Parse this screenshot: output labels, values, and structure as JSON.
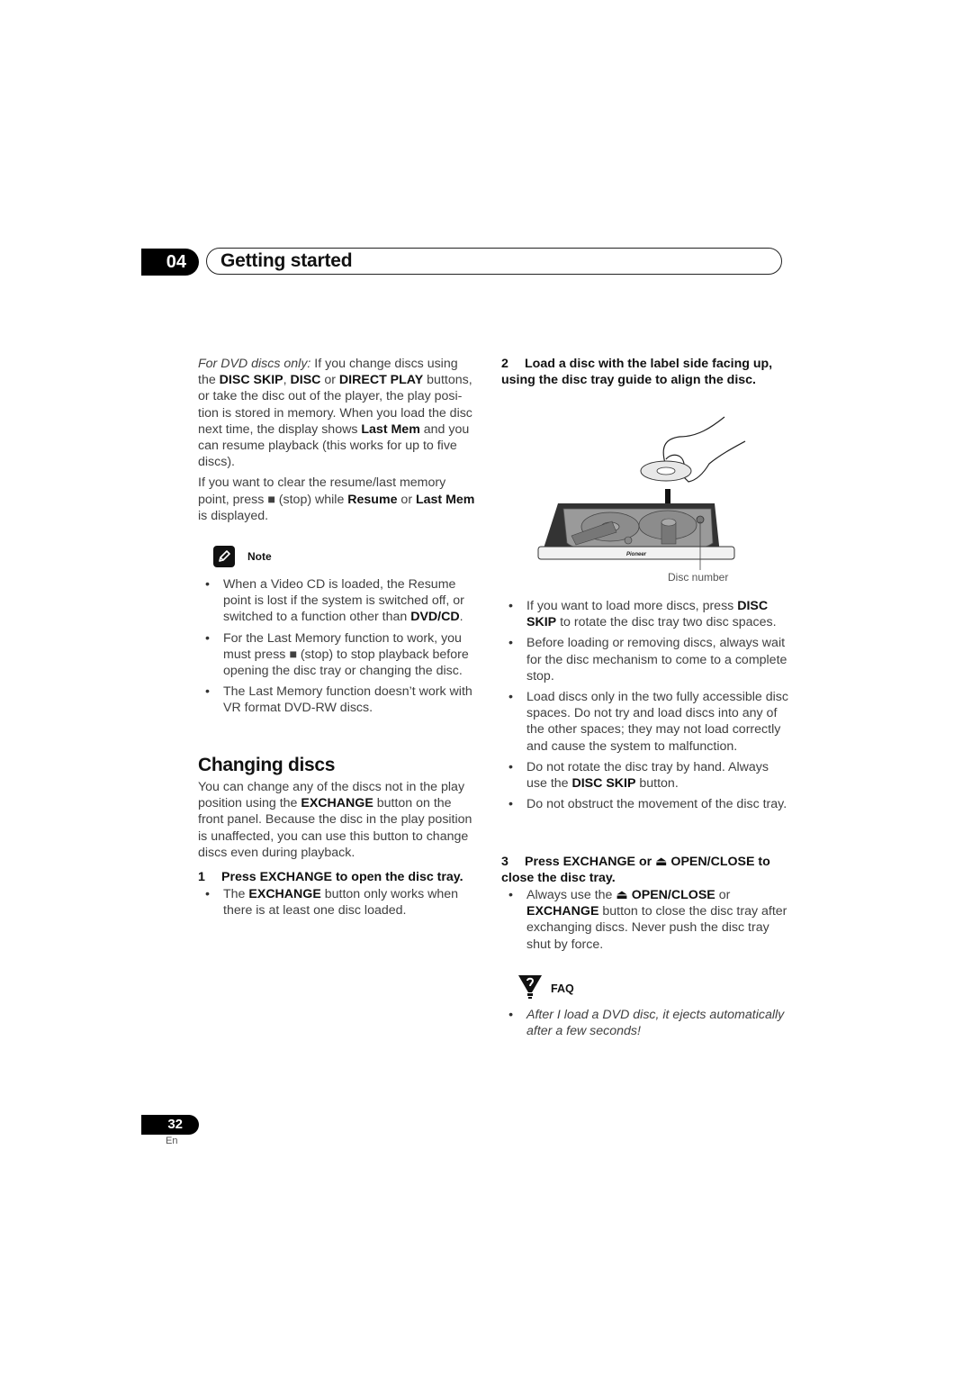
{
  "header": {
    "chapter_number": "04",
    "chapter_title": "Getting started"
  },
  "left": {
    "intro_para": {
      "italic_lead": "For DVD discs only:",
      "segments": [
        {
          "t": " If you change discs using the ",
          "b": false
        },
        {
          "t": "DISC SKIP",
          "b": true
        },
        {
          "t": ", ",
          "b": false
        },
        {
          "t": "DISC",
          "b": true
        },
        {
          "t": " or ",
          "b": false
        },
        {
          "t": "DIRECT PLAY",
          "b": true
        },
        {
          "t": " buttons, or take the disc out of the player, the play posi-tion is stored in memory. When you load the disc next time, the display shows ",
          "b": false
        },
        {
          "t": "Last Mem",
          "b": true
        },
        {
          "t": " and you can resume playback (this works for up to five discs).",
          "b": false
        }
      ]
    },
    "clear_para": {
      "segments": [
        {
          "t": "If you want to clear the resume/last memory point, press ■ (stop) while ",
          "b": false
        },
        {
          "t": "Resume",
          "b": true
        },
        {
          "t": " or ",
          "b": false
        },
        {
          "t": "Last Mem",
          "b": true
        },
        {
          "t": " is displayed.",
          "b": false
        }
      ]
    },
    "note": {
      "icon": "pencil-icon",
      "label": "Note",
      "items": [
        [
          {
            "t": "When a Video CD is loaded, the Resume point is lost if the system is switched off, or switched to a function other than ",
            "b": false
          },
          {
            "t": "DVD/CD",
            "b": true
          },
          {
            "t": ".",
            "b": false
          }
        ],
        [
          {
            "t": "For the Last Memory function to work, you must press ■ (stop) to stop playback before opening the disc tray or changing the disc.",
            "b": false
          }
        ],
        [
          {
            "t": "The Last Memory function doesn’t work with VR format DVD-RW discs.",
            "b": false
          }
        ]
      ]
    },
    "section_title": "Changing discs",
    "section_para": [
      {
        "t": "You can change any of the discs not in the play position using the ",
        "b": false
      },
      {
        "t": "EXCHANGE",
        "b": true
      },
      {
        "t": " button on the front panel. Because the disc in the play position is unaffected, you can use this button to change discs even during playback.",
        "b": false
      }
    ],
    "step1": {
      "number": "1",
      "text": "Press EXCHANGE to open the disc tray.",
      "bullet": [
        {
          "t": "The ",
          "b": false
        },
        {
          "t": "EXCHANGE",
          "b": true
        },
        {
          "t": " button only works when there is at least one disc loaded.",
          "b": false
        }
      ]
    }
  },
  "right": {
    "step2": {
      "number": "2",
      "text": "Load a disc with the label side facing up, using the disc tray guide to align the disc."
    },
    "illustration": {
      "brand": "Pioneer",
      "caption": "Disc number"
    },
    "bullets": [
      [
        {
          "t": "If you want to load more discs, press ",
          "b": false
        },
        {
          "t": "DISC SKIP",
          "b": true
        },
        {
          "t": " to rotate the disc tray two disc spaces.",
          "b": false
        }
      ],
      [
        {
          "t": "Before loading or removing discs, always wait for the disc mechanism to come to a complete stop.",
          "b": false
        }
      ],
      [
        {
          "t": "Load discs only in the two fully accessible disc spaces. Do not try and load discs into any of the other spaces; they may not load correctly and cause the system to malfunction.",
          "b": false
        }
      ],
      [
        {
          "t": "Do not rotate the disc tray by hand. Always use the ",
          "b": false
        },
        {
          "t": "DISC SKIP",
          "b": true
        },
        {
          "t": " button.",
          "b": false
        }
      ],
      [
        {
          "t": "Do not obstruct the movement of the disc tray.",
          "b": false
        }
      ]
    ],
    "step3": {
      "number": "3",
      "text": "Press EXCHANGE or ⏏ OPEN/CLOSE to close the disc tray.",
      "bullet": [
        {
          "t": "Always use the ",
          "b": false
        },
        {
          "t": "⏏ OPEN/CLOSE",
          "b": true
        },
        {
          "t": " or ",
          "b": false
        },
        {
          "t": "EXCHANGE",
          "b": true
        },
        {
          "t": " button to close the disc tray after exchanging discs. Never push the disc tray shut by force.",
          "b": false
        }
      ]
    },
    "faq": {
      "icon": "faq-icon",
      "label": "FAQ",
      "items": [
        "After I load a DVD disc, it ejects automatically after a few seconds!"
      ]
    }
  },
  "footer": {
    "page_number": "32",
    "language": "En"
  }
}
